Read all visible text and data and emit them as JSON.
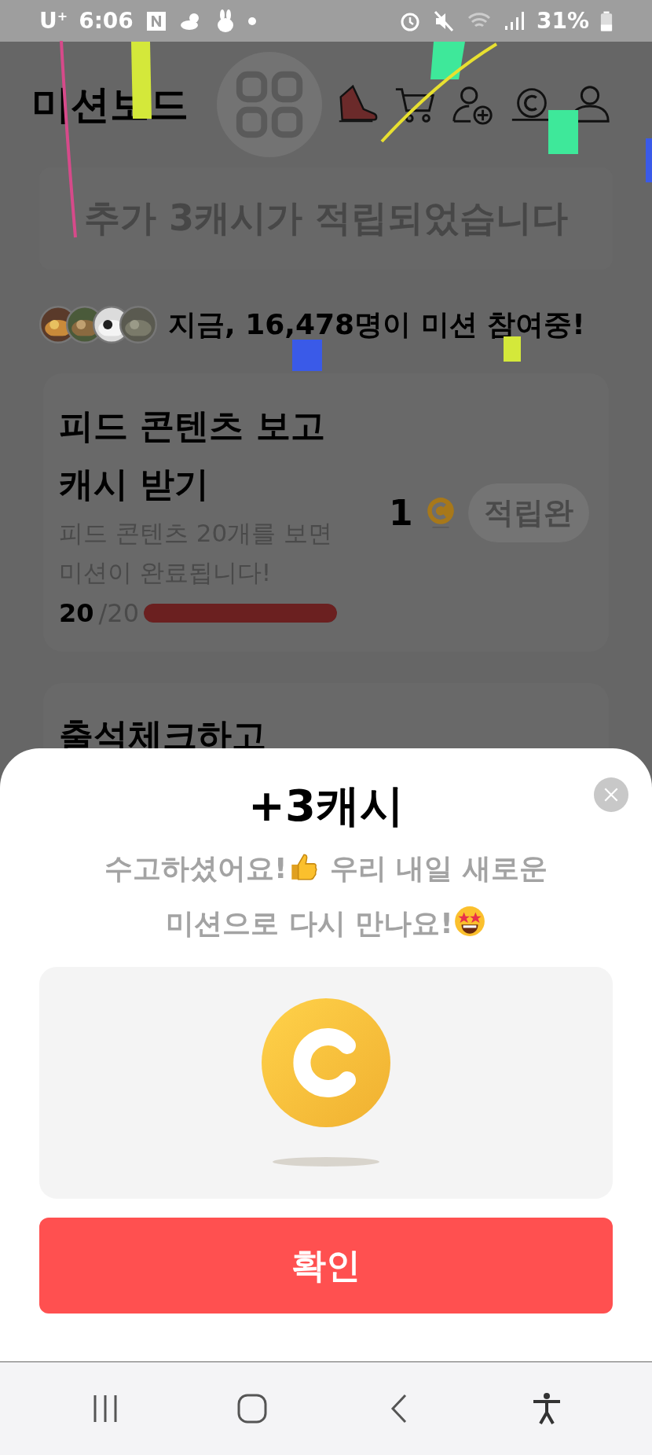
{
  "status_bar": {
    "carrier": "U$^{+}$",
    "time": "6:06",
    "battery": "31%"
  },
  "header": {
    "title": "미션보드"
  },
  "banner": {
    "text": "추가 3캐시가 적립되었습니다"
  },
  "participants": {
    "text": "지금, 16,478명이 미션 참여중!"
  },
  "missions": [
    {
      "title": "피드 콘텐츠 보고 캐시 받기",
      "description": "피드 콘텐츠 20개를 보면 미션이 완료됩니다!",
      "count": "20",
      "total": "/20",
      "level": 1,
      "reward": "1",
      "button": "적립완"
    },
    {
      "title": "출석체크하고"
    }
  ],
  "modal": {
    "title": "+3캐시",
    "message": [
      {
        "text": "수고하셨어요!",
        "kind": "thumbs_up"
      },
      {
        "text": "우리 내일 새로운"
      },
      {
        "text": "미션으로 다시 만나요!",
        "kind": "star_eyes"
      }
    ],
    "button": "확인"
  }
}
